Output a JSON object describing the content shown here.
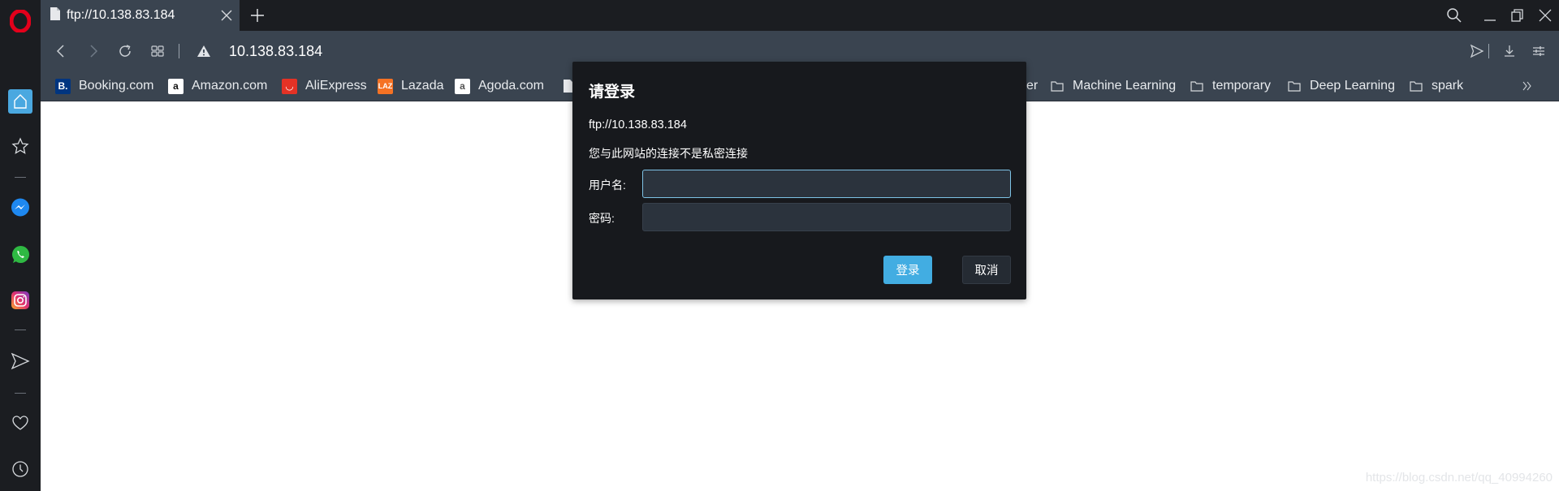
{
  "browser": {
    "tab": {
      "title": "ftp://10.138.83.184",
      "icon": "document-icon"
    },
    "address_bar": {
      "url": "10.138.83.184",
      "security_icon": "warning-icon"
    },
    "bookmarks": [
      {
        "label": "Booking.com",
        "icon": "booking-icon",
        "color": "#003580"
      },
      {
        "label": "Amazon.com",
        "icon": "amazon-icon",
        "color": "#ffffff"
      },
      {
        "label": "AliExpress",
        "icon": "aliexpress-icon",
        "color": "#e43225"
      },
      {
        "label": "Lazada",
        "icon": "lazada-icon",
        "color": "#f57224"
      },
      {
        "label": "Agoda.com",
        "icon": "agoda-icon",
        "color": "#ffffff"
      },
      {
        "label": "",
        "icon": "document-icon"
      },
      {
        "label": "er",
        "icon": ""
      },
      {
        "label": "Machine Learning",
        "icon": "folder-icon"
      },
      {
        "label": "temporary",
        "icon": "folder-icon"
      },
      {
        "label": "Deep Learning",
        "icon": "folder-icon"
      },
      {
        "label": "spark",
        "icon": "folder-icon"
      }
    ],
    "sidebar": [
      "home-icon",
      "star-icon",
      "messenger-icon",
      "whatsapp-icon",
      "instagram-icon",
      "send-icon",
      "heart-icon",
      "history-icon"
    ]
  },
  "dialog": {
    "title": "请登录",
    "url": "ftp://10.138.83.184",
    "warning": "您与此网站的连接不是私密连接",
    "username_label": "用户名:",
    "username_value": "",
    "password_label": "密码:",
    "password_value": "",
    "login_label": "登录",
    "cancel_label": "取消"
  },
  "watermark": "https://blog.csdn.net/qq_40994260",
  "colors": {
    "accent": "#42ade2",
    "chrome": "#3a4450",
    "dark": "#1b1d21",
    "opera_red": "#e3001b"
  }
}
